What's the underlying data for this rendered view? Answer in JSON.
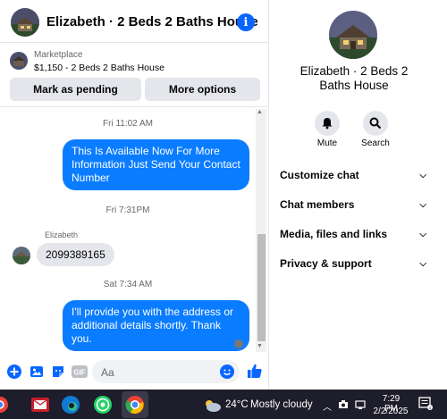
{
  "chat": {
    "title": "Elizabeth · 2 Beds 2 Baths House",
    "marketplace_label": "Marketplace",
    "listing": "$1,150 - 2 Beds 2 Baths House",
    "mark_pending_label": "Mark as pending",
    "more_options_label": "More options",
    "messages": [
      {
        "type": "timestamp",
        "text": "Fri 11:02 AM"
      },
      {
        "type": "outgoing",
        "lines": [
          "This Is Available Now For More",
          "Information Just Send Your Contact",
          "Number"
        ]
      },
      {
        "type": "timestamp",
        "text": "Fri 7:31PM"
      },
      {
        "type": "sender",
        "text": "Elizabeth"
      },
      {
        "type": "incoming",
        "text": "2099389165"
      },
      {
        "type": "timestamp",
        "text": "Sat 7:34 AM"
      },
      {
        "type": "outgoing",
        "lines": [
          "I'll provide you with the address or",
          "additional details shortly. Thank you."
        ]
      }
    ],
    "composer": {
      "placeholder": "Aa"
    }
  },
  "side": {
    "name_lines": [
      "Elizabeth · 2 Beds 2",
      "Baths House"
    ],
    "actions": [
      {
        "icon": "bell-icon",
        "label": "Mute"
      },
      {
        "icon": "search-icon",
        "label": "Search"
      }
    ],
    "sections": [
      "Customize chat",
      "Chat members",
      "Media, files and links",
      "Privacy & support"
    ]
  },
  "taskbar": {
    "weather_temp": "24°C",
    "weather_desc": "Mostly cloudy",
    "time": "7:29 PM",
    "date": "2/2/2025"
  },
  "colors": {
    "accent": "#0a7cff",
    "bubble_incoming": "#e4e6eb",
    "taskbar": "#1d1d2b"
  }
}
